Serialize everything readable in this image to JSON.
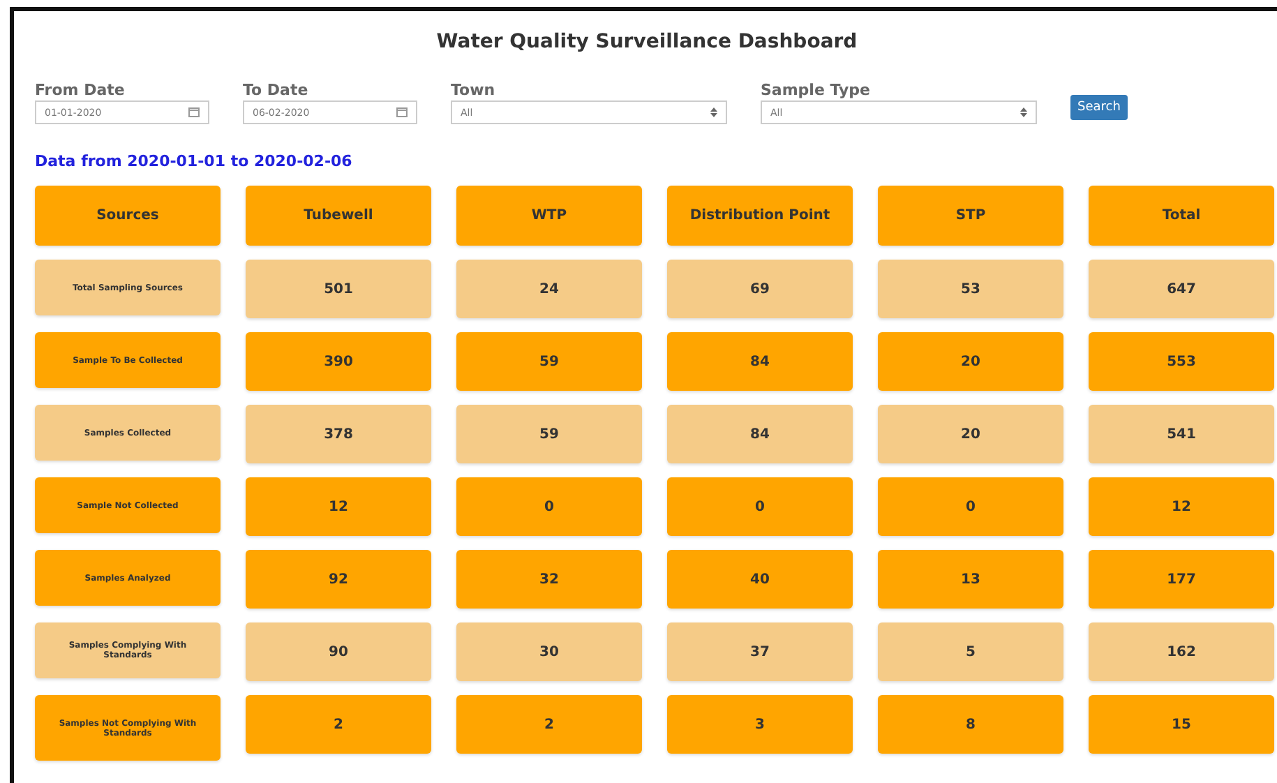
{
  "title": "Water Quality Surveillance Dashboard",
  "filters": [
    {
      "label": "From Date",
      "kind": "date",
      "value": "01-01-2020"
    },
    {
      "label": "To Date",
      "kind": "date",
      "value": "06-02-2020"
    },
    {
      "label": "Town",
      "kind": "select",
      "value": "All"
    },
    {
      "label": "Sample Type",
      "kind": "select",
      "value": "All"
    }
  ],
  "search_button": "Search",
  "range_text": "Data from 2020-01-01 to 2020-02-06",
  "table": {
    "columns": [
      "Sources",
      "Tubewell",
      "WTP",
      "Distribution Point",
      "STP",
      "Total"
    ],
    "rows": [
      {
        "label": "Total Sampling Sources",
        "color": "#f5cb87",
        "values": [
          "501",
          "24",
          "69",
          "53",
          "647"
        ]
      },
      {
        "label": "Sample To Be Collected",
        "color": "#ffa500",
        "values": [
          "390",
          "59",
          "84",
          "20",
          "553"
        ]
      },
      {
        "label": "Samples Collected",
        "color": "#f5cb87",
        "values": [
          "378",
          "59",
          "84",
          "20",
          "541"
        ]
      },
      {
        "label": "Sample Not Collected",
        "color": "#ffa500",
        "values": [
          "12",
          "0",
          "0",
          "0",
          "12"
        ]
      },
      {
        "label": "Samples Analyzed",
        "color": "#ffa500",
        "values": [
          "92",
          "32",
          "40",
          "13",
          "177"
        ]
      },
      {
        "label": "Samples Complying With Standards",
        "color": "#f5cb87",
        "values": [
          "90",
          "30",
          "37",
          "5",
          "162"
        ]
      },
      {
        "label": "Samples Not Complying With Standards",
        "color": "#ffa500",
        "values": [
          "2",
          "2",
          "3",
          "8",
          "15"
        ]
      }
    ]
  }
}
